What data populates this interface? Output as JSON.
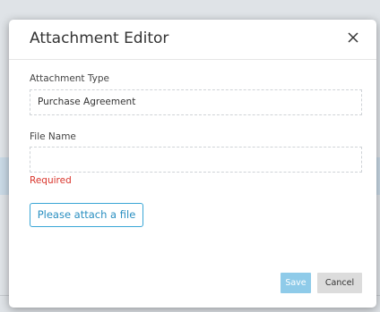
{
  "dialog": {
    "title": "Attachment Editor",
    "close_icon": "close-icon"
  },
  "fields": {
    "attachment_type": {
      "label": "Attachment Type",
      "value": "Purchase Agreement"
    },
    "file_name": {
      "label": "File Name",
      "value": "",
      "error": "Required"
    }
  },
  "attach_button": {
    "label": "Please attach a file"
  },
  "footer": {
    "save_label": "Save",
    "cancel_label": "Cancel"
  },
  "colors": {
    "accent": "#3aa6d6",
    "save_disabled": "#8fcbe9",
    "error": "#d9342b",
    "cancel_bg": "#dcdcdc"
  }
}
